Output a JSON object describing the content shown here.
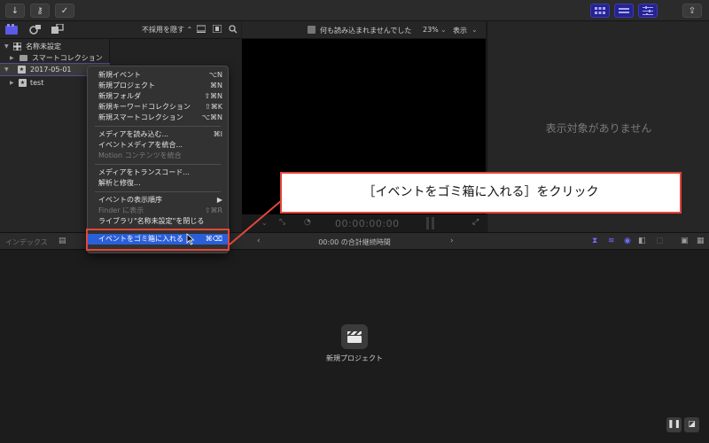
{
  "toolbar": {
    "import_icon": "↓",
    "key_icon": "⚷",
    "check_icon": "✓",
    "share_icon": "⇪"
  },
  "browser": {
    "filter_label": "不採用を隠す ⌃"
  },
  "sidebar": {
    "items": [
      {
        "label": "名称未設定",
        "icon": "grid-icon"
      },
      {
        "label": "スマートコレクション",
        "icon": "folder-icon"
      },
      {
        "label": "2017-05-01",
        "icon": "star-icon"
      },
      {
        "label": "test",
        "icon": "star-icon"
      }
    ]
  },
  "viewer": {
    "status": "何も読み込まれませんでした",
    "zoom": "23%",
    "display_menu": "表示",
    "timecode": "00:00:00:00"
  },
  "inspector": {
    "empty_message": "表示対象がありません"
  },
  "timeline": {
    "index_label": "インデックス",
    "duration": "00:00 の合計継続時間",
    "new_project_label": "新規プロジェクト"
  },
  "menu": {
    "items": [
      {
        "label": "新規イベント",
        "shortcut": "⌥N"
      },
      {
        "label": "新規プロジェクト",
        "shortcut": "⌘N"
      },
      {
        "label": "新規フォルダ",
        "shortcut": "⇧⌘N"
      },
      {
        "label": "新規キーワードコレクション",
        "shortcut": "⇧⌘K"
      },
      {
        "label": "新規スマートコレクション",
        "shortcut": "⌥⌘N"
      },
      {
        "label": "メディアを読み込む...",
        "shortcut": "⌘I"
      },
      {
        "label": "イベントメディアを統合...",
        "shortcut": ""
      },
      {
        "label": "Motion コンテンツを統合",
        "shortcut": ""
      },
      {
        "label": "メディアをトランスコード...",
        "shortcut": ""
      },
      {
        "label": "解析と修復...",
        "shortcut": ""
      },
      {
        "label": "イベントの表示順序",
        "shortcut": "▶"
      },
      {
        "label": "Finder に表示",
        "shortcut": "⇧⌘R"
      },
      {
        "label": "ライブラリ\"名称未設定\"を閉じる",
        "shortcut": ""
      },
      {
        "label": "イベントをゴミ箱に入れる",
        "shortcut": "⌘⌫"
      }
    ]
  },
  "callout": {
    "text": "［イベントをゴミ箱に入れる］をクリック"
  },
  "colors": {
    "highlight": "#2b5fd9",
    "annotation_red": "#e3463a",
    "accent": "#6f6dff"
  }
}
